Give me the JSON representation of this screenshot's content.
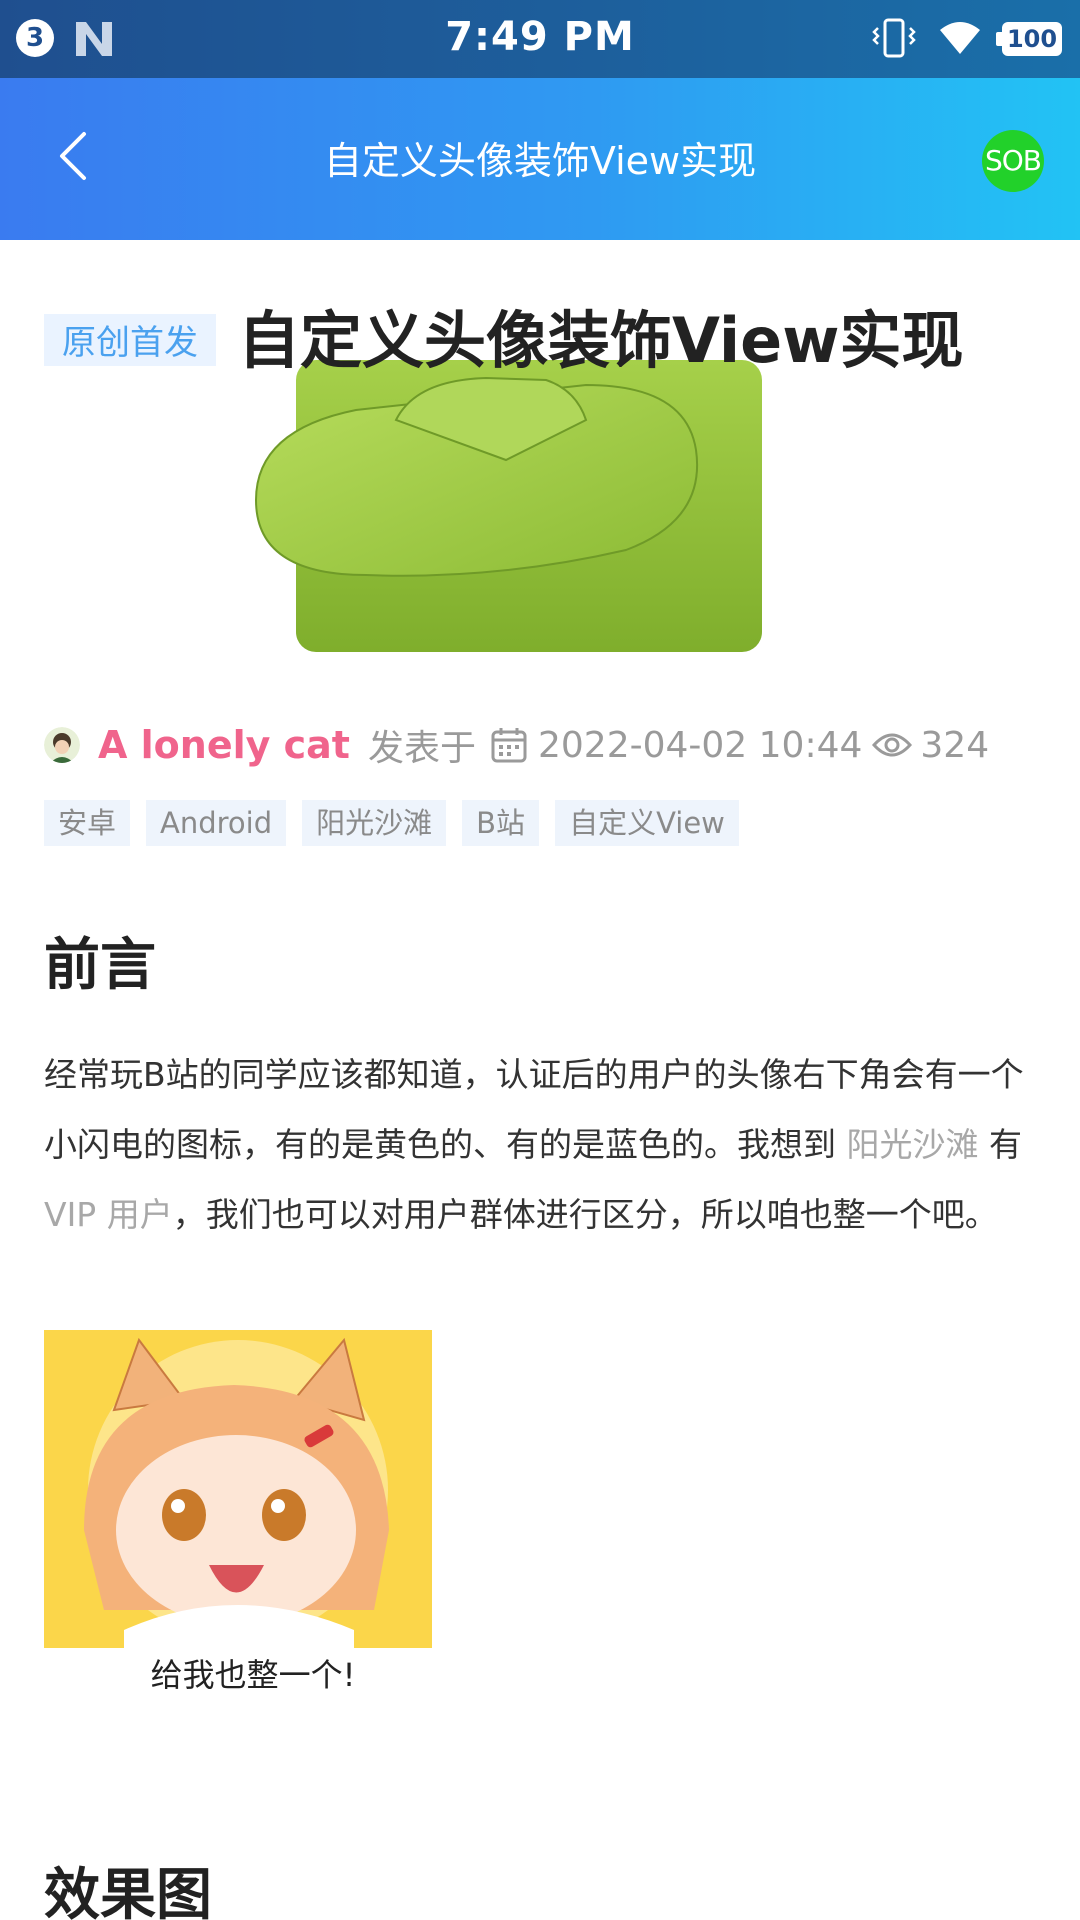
{
  "status_bar": {
    "notification_count": "3",
    "time": "7:49 PM",
    "battery": "100",
    "icons": [
      "n-logo-icon",
      "vibrate-icon",
      "wifi-icon",
      "battery-icon"
    ]
  },
  "app_bar": {
    "back_icon": "chevron-left-icon",
    "title": "自定义头像装饰View实现",
    "avatar_text": "SOB"
  },
  "article": {
    "badge": "原创首发",
    "title": "自定义头像装饰View实现",
    "author": "A lonely cat",
    "published_label": "发表于",
    "date": "2022-04-02 10:44",
    "views": "324",
    "tags": [
      "安卓",
      "Android",
      "阳光沙滩",
      "B站",
      "自定义View"
    ],
    "section1_heading": "前言",
    "paragraph": {
      "part1": "经常玩B站的同学应该都知道，认证后的用户的头像右下角会有一个小闪电的图标，有的是黄色的、有的是蓝色的。我想到 ",
      "link1": "阳光沙滩",
      "part2": " 有 ",
      "link2": "VIP 用户",
      "part3": "，我们也可以对用户群体进行区分，所以咱也整一个吧。"
    },
    "image_caption": "给我也整一个!",
    "section2_heading": "效果图"
  },
  "colors": {
    "status_bar": "#1f4f8f",
    "app_bar_start": "#3a7bf0",
    "app_bar_end": "#22c3f4",
    "author": "#f0648c",
    "badge_text": "#4aa1ef",
    "sob_green": "#22d12a"
  }
}
